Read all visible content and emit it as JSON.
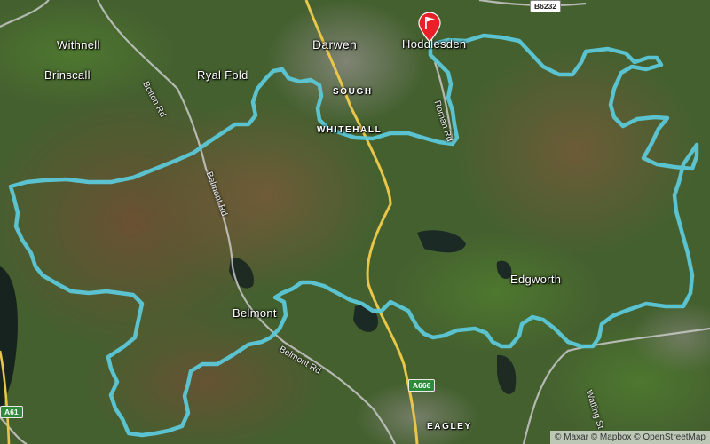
{
  "map": {
    "style": "satellite-streets",
    "colors": {
      "route": "#5cc8d8",
      "road_major": "#e8c64a",
      "road_minor": "#bdbdbd",
      "marker": "#e8202a"
    },
    "marker": {
      "icon": "flag-marker-icon"
    },
    "place_labels": {
      "withnell": "Withnell",
      "brinscall": "Brinscall",
      "ryal_fold": "Ryal Fold",
      "darwen": "Darwen",
      "hoddlesden": "Hoddlesden",
      "sough": "SOUGH",
      "whitehall": "WHITEHALL",
      "belmont": "Belmont",
      "edgworth": "Edgworth",
      "eagley": "EAGLEY"
    },
    "road_labels": {
      "bolton_rd": "Bolton Rd",
      "belmont_rd_north": "Belmont Rd",
      "belmont_rd_south": "Belmont Rd",
      "roman_rd": "Roman Rd",
      "watling_st": "Watling St"
    },
    "shields": {
      "b6232": "B6232",
      "a666": "A666",
      "a61": "A61"
    },
    "attribution": "© Maxar © Mapbox © OpenStreetMap"
  }
}
